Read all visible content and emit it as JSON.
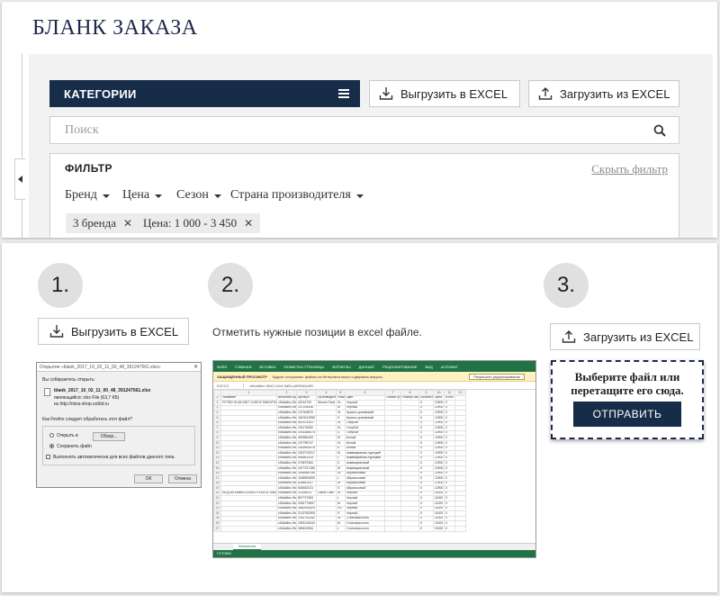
{
  "header": {
    "title": "БЛАНК ЗАКАЗА"
  },
  "toolbar": {
    "categories_label": "КАТЕГОРИИ",
    "download_label": "Выгрузить в EXCEL",
    "upload_label": "Загрузить из EXCEL"
  },
  "search": {
    "placeholder": "Поиск"
  },
  "filter": {
    "title": "ФИЛЬТР",
    "hide_label": "Скрыть фильтр",
    "dropdowns": [
      "Бренд",
      "Цена",
      "Сезон",
      "Страна производителя"
    ],
    "chips": [
      "3 бренда",
      "Цена: 1 000 - 3 450"
    ]
  },
  "steps": [
    {
      "number": "1.",
      "button_label": "Выгрузить в EXCEL"
    },
    {
      "number": "2.",
      "text": "Отметить нужные позиции в excel файле."
    },
    {
      "number": "3.",
      "button_label": "Загрузить из EXCEL"
    }
  ],
  "dialog": {
    "title": "Открытие «blank_2017_10_02_11_00_48_391247561.xlsx»",
    "line1": "Вы собираетесь открыть:",
    "filename": "blank_2017_10_02_11_00_48_391247561.xlsx",
    "filetype": "являющийся: xlsx File (63,7 КБ)",
    "source": "из http://miss-shop.sotbit.ru",
    "question": "Как Firefox следует обработать этот файл?",
    "open_with": "Открыть в",
    "browse": "Обзор...",
    "save_file": "Сохранить файл",
    "auto": "Выполнять автоматически для всех файлов данного типа.",
    "ok": "ОК",
    "cancel": "Отмена"
  },
  "excel": {
    "tabs": [
      "ФАЙЛ",
      "ГЛАВНАЯ",
      "ВСТАВКА",
      "РАЗМЕТКА СТРАНИЦЫ",
      "ФОРМУЛЫ",
      "ДАННЫЕ",
      "РЕЦЕНЗИРОВАНИЕ",
      "ВИД",
      "ACROBAT"
    ],
    "warning_title": "ЗАЩИЩЕННЫЙ ПРОСМОТР",
    "warning_text": "Будьте осторожны: файлы из Интернета могут содержать вирусы.",
    "enable_label": "Разрешить редактирование",
    "cell_ref": "K2CC3",
    "formula": "c0b4a8ec-9b43-11e4-9af3-c4f0f0d2c8f0",
    "col_headers": [
      "1",
      "2",
      "3",
      "4",
      "5",
      "6",
      "7",
      "8",
      "9",
      "10",
      "11",
      "12"
    ],
    "header_row": [
      "Название",
      "Внешний код",
      "Артикул",
      "Производитель",
      "Размер",
      "Цвет",
      "Обхват груди",
      "Размер чашки",
      "Количество",
      "Цена",
      "Итого"
    ],
    "rows": [
      [
        "FITTED SLUB KNIT V-NECK SWEATSHIRT",
        "c0b4a8ec-9b43",
        "42151790",
        "Steven Paris",
        "XL",
        "Черный",
        "",
        "",
        "0",
        "12900",
        "0"
      ],
      [
        "",
        "c0b4a8ec-9b43",
        "247104536",
        "",
        "M",
        "Черный",
        "",
        "",
        "0",
        "12900",
        "0"
      ],
      [
        "",
        "c0b4a8ec-9b43",
        "137304870",
        "",
        "XL",
        "Красно-оранжевый",
        "",
        "",
        "0",
        "12900",
        "0"
      ],
      [
        "",
        "c0b4a8ec-9b43",
        "1610012955",
        "",
        "S",
        "Красно-оранжевый",
        "",
        "",
        "0",
        "12900",
        "0"
      ],
      [
        "",
        "c0b4a8ec-9b43",
        "557674261",
        "",
        "XL",
        "Голубой",
        "",
        "",
        "0",
        "12900",
        "0"
      ],
      [
        "",
        "c0b4a8ec-9b43",
        "191176950",
        "",
        "XL",
        "Голубой",
        "",
        "",
        "0",
        "12900",
        "0"
      ],
      [
        "",
        "c0b4a8ec-9b43",
        "1901558075",
        "",
        "S",
        "Голубой",
        "",
        "",
        "0",
        "12900",
        "0"
      ],
      [
        "",
        "c0b4a8ec-9b43",
        "360956409",
        "",
        "M",
        "Белый",
        "",
        "",
        "0",
        "12900",
        "0"
      ],
      [
        "",
        "c0b4a8ec-9b43",
        "137758747",
        "",
        "XL",
        "Белый",
        "",
        "",
        "0",
        "12900",
        "0"
      ],
      [
        "",
        "c0b4a8ec-9b43",
        "1509905078",
        "",
        "S",
        "Белый",
        "",
        "",
        "0",
        "12900",
        "0"
      ],
      [
        "",
        "c0b4a8ec-9b43",
        "1522710517",
        "",
        "M",
        "Аквамариново-турецкий",
        "",
        "",
        "0",
        "12900",
        "0"
      ],
      [
        "",
        "c0b4a8ec-9b43",
        "565661425",
        "",
        "L",
        "Аквамариново-турецкий",
        "",
        "",
        "0",
        "12900",
        "0"
      ],
      [
        "",
        "c0b4a8ec-9b43",
        "275679484",
        "",
        "S",
        "Аквамариновый",
        "",
        "",
        "0",
        "12900",
        "0"
      ],
      [
        "",
        "c0b4a8ec-9b43",
        "1677237180",
        "",
        "M",
        "Аквамариновый",
        "",
        "",
        "0",
        "12900",
        "0"
      ],
      [
        "",
        "c0b4a8ec-9b43",
        "1636286786",
        "",
        "XL",
        "Абрикосовый",
        "",
        "",
        "0",
        "12900",
        "0"
      ],
      [
        "",
        "c0b4a8ec-9b43",
        "1166590695",
        "",
        "L",
        "Абрикосовый",
        "",
        "",
        "0",
        "12900",
        "0"
      ],
      [
        "",
        "c0b4a8ec-9b43",
        "828657617",
        "",
        "M",
        "Абрикосовый",
        "",
        "",
        "0",
        "12900",
        "0"
      ],
      [
        "",
        "c0b4a8ec-9b43",
        "845462021",
        "",
        "S",
        "Абрикосовый",
        "",
        "",
        "0",
        "12900",
        "0"
      ],
      [
        "SEQUIN EMBELLISHED FLEECE SWEATSHIRT",
        "c0b4a8ec-9b43",
        "12309031",
        "Calvin Clein",
        "XL",
        "Черный",
        "",
        "",
        "0",
        "11000",
        "0"
      ],
      [
        "",
        "c0b4a8ec-9b43",
        "857737083",
        "",
        "L",
        "Черный",
        "",
        "",
        "0",
        "11000",
        "0"
      ],
      [
        "",
        "c0b4a8ec-9b43",
        "2061779607",
        "",
        "M",
        "Черный",
        "",
        "",
        "0",
        "11000",
        "0"
      ],
      [
        "",
        "c0b4a8ec-9b43",
        "1860190829",
        "",
        "XS",
        "Черный",
        "",
        "",
        "0",
        "11000",
        "0"
      ],
      [
        "",
        "c0b4a8ec-9b43",
        "2102762909",
        "",
        "S",
        "Черный",
        "",
        "",
        "0",
        "11000",
        "0"
      ],
      [
        "",
        "c0b4a8ec-9b43",
        "2041753252",
        "",
        "XL",
        "Слоновая кость",
        "",
        "",
        "0",
        "11000",
        "0"
      ],
      [
        "",
        "c0b4a8ec-9b43",
        "1551016042",
        "",
        "M",
        "Слоновая кость",
        "",
        "",
        "0",
        "11000",
        "0"
      ],
      [
        "",
        "c0b4a8ec-9b43",
        "289433084",
        "",
        "L",
        "Слоновая кость",
        "",
        "",
        "0",
        "11000",
        "0"
      ]
    ],
    "sheet_name": "Worksheet",
    "status": "ГОТОВО"
  },
  "dropzone": {
    "text_line1": "Выберите файл или",
    "text_line2": "перетащите его сюда.",
    "submit_label": "ОТПРАВИТЬ"
  }
}
